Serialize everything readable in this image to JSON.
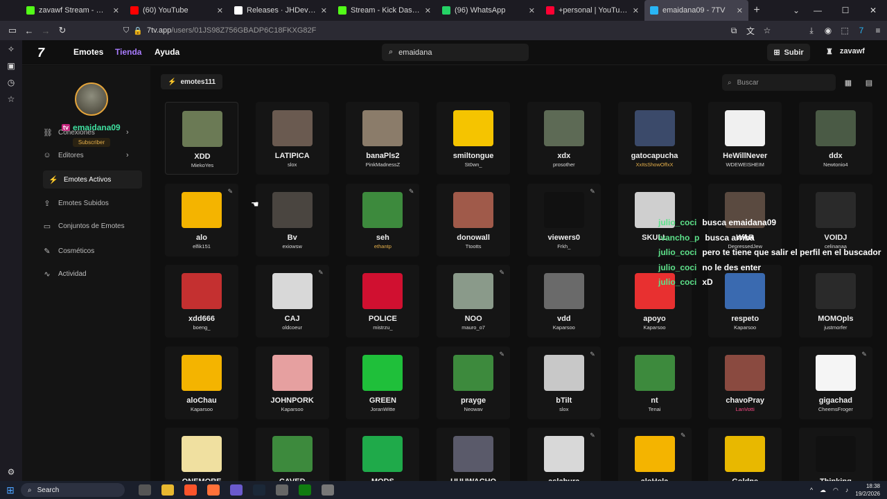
{
  "browser": {
    "tabs": [
      {
        "title": "zavawf Stream - Watch Live on Kick",
        "fav": "#53fc18",
        "active": false
      },
      {
        "title": "(60) YouTube",
        "fav": "#ff0000",
        "active": false
      },
      {
        "title": "Releases · JHDev2006/Super-Mario-Bros",
        "fav": "#ffffff",
        "active": false
      },
      {
        "title": "Stream - Kick Dashboard",
        "fav": "#53fc18",
        "active": false
      },
      {
        "title": "(96) WhatsApp",
        "fav": "#25d366",
        "active": false
      },
      {
        "title": "+personal | YouTube Music",
        "fav": "#ff0033",
        "active": false
      },
      {
        "title": "emaidana09 - 7TV",
        "fav": "#29b6f6",
        "active": true
      }
    ],
    "url_domain": "7tv.app",
    "url_path": "/users/01JS98Z756GBADP6C18FKXG82F"
  },
  "site": {
    "logo": "7",
    "nav": {
      "emotes": "Emotes",
      "store": "Tienda",
      "help": "Ayuda"
    },
    "search_value": "emaidana",
    "upload": "Subir",
    "username": "zavawf"
  },
  "profile": {
    "username": "emaidana09",
    "badge": "Subscriber",
    "menu": [
      {
        "label": "Conexiones",
        "icon": "link-icon",
        "chev": true
      },
      {
        "label": "Editores",
        "icon": "user-icon",
        "chev": true
      },
      {
        "label": "Emotes Activos",
        "icon": "bolt-icon",
        "chev": false,
        "selected": true
      },
      {
        "label": "Emotes Subidos",
        "icon": "upload-icon",
        "chev": false
      },
      {
        "label": "Conjuntos de Emotes",
        "icon": "folder-icon",
        "chev": false
      },
      {
        "label": "Cosméticos",
        "icon": "brush-icon",
        "chev": false
      },
      {
        "label": "Actividad",
        "icon": "activity-icon",
        "chev": false
      }
    ]
  },
  "emote_set": {
    "name": "emotes111",
    "search_placeholder": "Buscar"
  },
  "emotes": [
    {
      "name": "XDD",
      "owner": "MiekoYes",
      "color": "#6b7a55",
      "pen": false,
      "hl": true
    },
    {
      "name": "LATIPICA",
      "owner": "slox",
      "color": "#6a5a50",
      "pen": false
    },
    {
      "name": "banaPls2",
      "owner": "PinkMadnessZ",
      "color": "#8b7c6a",
      "pen": false
    },
    {
      "name": "smiltongue",
      "owner": "St0wn_",
      "color": "#f5c400",
      "pen": false
    },
    {
      "name": "xdx",
      "owner": "prosother",
      "color": "#5d6a55",
      "pen": false
    },
    {
      "name": "gatocapucha",
      "owner": "XxItsShowOffxX",
      "color": "#3b4a6a",
      "pen": false,
      "owner_color": "#e6b04a"
    },
    {
      "name": "HeWillNever",
      "owner": "WDEWEISHEIM",
      "color": "#f0f0f0",
      "pen": false
    },
    {
      "name": "ddx",
      "owner": "Newtonio4",
      "color": "#4a5a45",
      "pen": false
    },
    {
      "name": "alo",
      "owner": "elfik151",
      "color": "#f4b400",
      "pen": true
    },
    {
      "name": "Bv",
      "owner": "exiowsw",
      "color": "#4a4540",
      "pen": false
    },
    {
      "name": "seh",
      "owner": "ethantp",
      "color": "#3d8a3d",
      "pen": true,
      "owner_color": "#e6b04a"
    },
    {
      "name": "donowall",
      "owner": "Ttootts",
      "color": "#a05a4a",
      "pen": false
    },
    {
      "name": "viewers0",
      "owner": "Frkh_",
      "color": "#111111",
      "pen": true
    },
    {
      "name": "SKULL",
      "owner": "",
      "color": "#cfcfcf",
      "pen": false
    },
    {
      "name": "WAR",
      "owner": "DepressedJew",
      "color": "#5a4a40",
      "pen": false
    },
    {
      "name": "VOIDJ",
      "owner": "celinanaa",
      "color": "#2a2a2a",
      "pen": false
    },
    {
      "name": "xdd666",
      "owner": "boeng_",
      "color": "#c43030",
      "pen": false
    },
    {
      "name": "CAJ",
      "owner": "oldcoeur",
      "color": "#d8d8d8",
      "pen": true
    },
    {
      "name": "POLICE",
      "owner": "mistrzu_",
      "color": "#d01030",
      "pen": false
    },
    {
      "name": "NOO",
      "owner": "mauro_o7",
      "color": "#8a9a8a",
      "pen": true
    },
    {
      "name": "vdd",
      "owner": "Kaparsoo",
      "color": "#6a6a6a",
      "pen": false
    },
    {
      "name": "apoyo",
      "owner": "Kaparsoo",
      "color": "#e83030",
      "pen": false
    },
    {
      "name": "respeto",
      "owner": "Kaparsoo",
      "color": "#3a6ab0",
      "pen": false
    },
    {
      "name": "MOMOpls",
      "owner": "justmorfer",
      "color": "#2a2a2a",
      "pen": false
    },
    {
      "name": "aloChau",
      "owner": "Kaparsoo",
      "color": "#f4b400",
      "pen": false
    },
    {
      "name": "JOHNPORK",
      "owner": "Kaparsoo",
      "color": "#e6a0a0",
      "pen": false
    },
    {
      "name": "GREEN",
      "owner": "JoranWitte",
      "color": "#1fbf3a",
      "pen": false
    },
    {
      "name": "prayge",
      "owner": "Neowav",
      "color": "#3d8a3d",
      "pen": true
    },
    {
      "name": "bTilt",
      "owner": "slox",
      "color": "#c8c8c8",
      "pen": true
    },
    {
      "name": "nt",
      "owner": "Tenai",
      "color": "#3d8a3d",
      "pen": false
    },
    {
      "name": "chavoPray",
      "owner": "LanVotti",
      "color": "#8a4a40",
      "pen": false,
      "owner_color": "#ff4d8a"
    },
    {
      "name": "gigachad",
      "owner": "CheemsFroger",
      "color": "#f5f5f5",
      "pen": true
    },
    {
      "name": "ONEMORE",
      "owner": "",
      "color": "#f0e0a0",
      "pen": false
    },
    {
      "name": "CAVED",
      "owner": "",
      "color": "#3d8a3d",
      "pen": false
    },
    {
      "name": "MODS",
      "owner": "",
      "color": "#1faa4a",
      "pen": false
    },
    {
      "name": "UUUWACHO",
      "owner": "",
      "color": "#5a5a6a",
      "pen": false
    },
    {
      "name": "aslabura",
      "owner": "",
      "color": "#d8d8d8",
      "pen": true
    },
    {
      "name": "aloHola",
      "owner": "",
      "color": "#f4b400",
      "pen": true
    },
    {
      "name": "Goldpe",
      "owner": "",
      "color": "#e8b800",
      "pen": false
    },
    {
      "name": "Thinking",
      "owner": "",
      "color": "#111111",
      "pen": false
    }
  ],
  "chat": [
    {
      "user": "julio_coci",
      "msg": "busca emaidana09"
    },
    {
      "user": "ivancho_p",
      "msg": "busca arriba"
    },
    {
      "user": "julio_coci",
      "msg": "pero te tiene que salir el perfil en el buscador"
    },
    {
      "user": "julio_coci",
      "msg": "no le des enter"
    },
    {
      "user": "julio_coci",
      "msg": "xD"
    }
  ],
  "taskbar": {
    "search": "Search",
    "time": "18:38",
    "date": "19/2/2026"
  }
}
